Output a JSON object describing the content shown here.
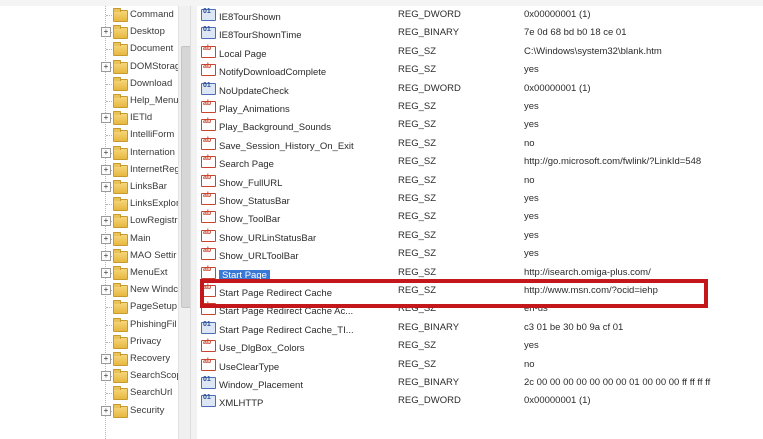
{
  "tree": {
    "items": [
      {
        "label": "Command",
        "expander": ""
      },
      {
        "label": "Desktop",
        "expander": "+"
      },
      {
        "label": "Document",
        "expander": ""
      },
      {
        "label": "DOMStorag",
        "expander": "+"
      },
      {
        "label": "Download",
        "expander": ""
      },
      {
        "label": "Help_Menu",
        "expander": ""
      },
      {
        "label": "IETld",
        "expander": "+"
      },
      {
        "label": "IntelliForm",
        "expander": ""
      },
      {
        "label": "Internation",
        "expander": "+"
      },
      {
        "label": "InternetReg",
        "expander": "+"
      },
      {
        "label": "LinksBar",
        "expander": "+"
      },
      {
        "label": "LinksExplor",
        "expander": ""
      },
      {
        "label": "LowRegistr",
        "expander": "+"
      },
      {
        "label": "Main",
        "expander": "+"
      },
      {
        "label": "MAO Settir",
        "expander": "+"
      },
      {
        "label": "MenuExt",
        "expander": "+"
      },
      {
        "label": "New Windc",
        "expander": "+"
      },
      {
        "label": "PageSetup",
        "expander": ""
      },
      {
        "label": "PhishingFil",
        "expander": ""
      },
      {
        "label": "Privacy",
        "expander": ""
      },
      {
        "label": "Recovery",
        "expander": "+"
      },
      {
        "label": "SearchScop",
        "expander": "+"
      },
      {
        "label": "SearchUrl",
        "expander": ""
      },
      {
        "label": "Security",
        "expander": "+"
      }
    ]
  },
  "values": {
    "rows": [
      {
        "name": "IE8TourShown",
        "type": "REG_DWORD",
        "data": "0x00000001 (1)",
        "kind": "bin"
      },
      {
        "name": "IE8TourShownTime",
        "type": "REG_BINARY",
        "data": "7e 0d 68 bd b0 18 ce 01",
        "kind": "bin"
      },
      {
        "name": "Local Page",
        "type": "REG_SZ",
        "data": "C:\\Windows\\system32\\blank.htm",
        "kind": "sz"
      },
      {
        "name": "NotifyDownloadComplete",
        "type": "REG_SZ",
        "data": "yes",
        "kind": "sz"
      },
      {
        "name": "NoUpdateCheck",
        "type": "REG_DWORD",
        "data": "0x00000001 (1)",
        "kind": "bin"
      },
      {
        "name": "Play_Animations",
        "type": "REG_SZ",
        "data": "yes",
        "kind": "sz"
      },
      {
        "name": "Play_Background_Sounds",
        "type": "REG_SZ",
        "data": "yes",
        "kind": "sz"
      },
      {
        "name": "Save_Session_History_On_Exit",
        "type": "REG_SZ",
        "data": "no",
        "kind": "sz"
      },
      {
        "name": "Search Page",
        "type": "REG_SZ",
        "data": "http://go.microsoft.com/fwlink/?LinkId=548",
        "kind": "sz"
      },
      {
        "name": "Show_FullURL",
        "type": "REG_SZ",
        "data": "no",
        "kind": "sz"
      },
      {
        "name": "Show_StatusBar",
        "type": "REG_SZ",
        "data": "yes",
        "kind": "sz"
      },
      {
        "name": "Show_ToolBar",
        "type": "REG_SZ",
        "data": "yes",
        "kind": "sz"
      },
      {
        "name": "Show_URLinStatusBar",
        "type": "REG_SZ",
        "data": "yes",
        "kind": "sz"
      },
      {
        "name": "Show_URLToolBar",
        "type": "REG_SZ",
        "data": "yes",
        "kind": "sz"
      },
      {
        "name": "Start Page",
        "type": "REG_SZ",
        "data": "http://isearch.omiga-plus.com/",
        "kind": "sz",
        "selected": true
      },
      {
        "name": "Start Page Redirect Cache",
        "type": "REG_SZ",
        "data": "http://www.msn.com/?ocid=iehp",
        "kind": "sz"
      },
      {
        "name": "Start Page Redirect Cache Ac...",
        "type": "REG_SZ",
        "data": "en-us",
        "kind": "sz"
      },
      {
        "name": "Start Page Redirect Cache_TI...",
        "type": "REG_BINARY",
        "data": "c3 01 be 30 b0 9a cf 01",
        "kind": "bin"
      },
      {
        "name": "Use_DlgBox_Colors",
        "type": "REG_SZ",
        "data": "yes",
        "kind": "sz"
      },
      {
        "name": "UseClearType",
        "type": "REG_SZ",
        "data": "no",
        "kind": "sz"
      },
      {
        "name": "Window_Placement",
        "type": "REG_BINARY",
        "data": "2c 00 00 00 00 00 00 00 01 00 00 00 ff ff ff ff",
        "kind": "bin"
      },
      {
        "name": "XMLHTTP",
        "type": "REG_DWORD",
        "data": "0x00000001 (1)",
        "kind": "bin"
      }
    ]
  },
  "colors": {
    "highlight_border": "#c4171c",
    "selection": "#3a78d6"
  }
}
